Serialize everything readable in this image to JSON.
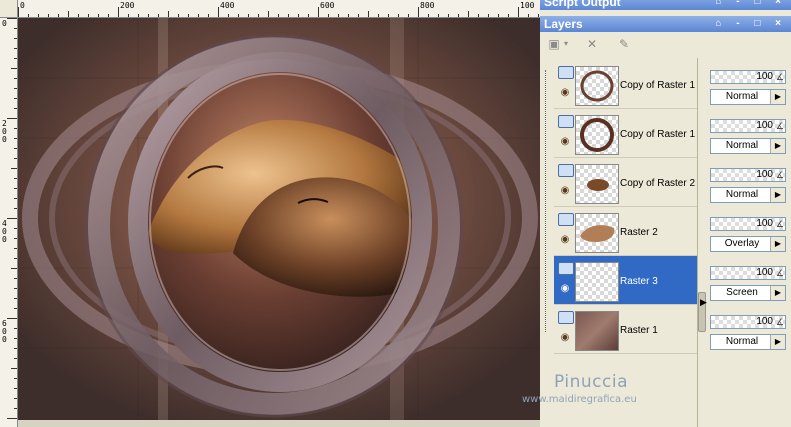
{
  "app": {
    "script_output_title": "Script Output",
    "layers_title": "Layers",
    "title_buttons": "⌂ - □ ×"
  },
  "rulers": {
    "top_labels": [
      "0",
      "200",
      "400",
      "600",
      "800",
      "100"
    ],
    "left_labels": [
      "0",
      "2 0 0",
      "4 0 0",
      "6 0 0"
    ]
  },
  "toolbar": {
    "icons": [
      "new-layer-icon",
      "dropdown-arrow-icon",
      "delete-layer-icon",
      "properties-icon"
    ]
  },
  "layers": [
    {
      "name": "Copy of Raster 1",
      "opacity": "100",
      "blend": "Normal",
      "thumb": "ring",
      "selected": false
    },
    {
      "name": "Copy of Raster 1",
      "opacity": "100",
      "blend": "Normal",
      "thumb": "ring-thin",
      "selected": false
    },
    {
      "name": "Copy of Raster 2",
      "opacity": "100",
      "blend": "Normal",
      "thumb": "blob",
      "selected": false
    },
    {
      "name": "Raster 2",
      "opacity": "100",
      "blend": "Overlay",
      "thumb": "faces",
      "selected": false
    },
    {
      "name": "Raster 3",
      "opacity": "100",
      "blend": "Screen",
      "thumb": "empty",
      "selected": true
    },
    {
      "name": "Raster 1",
      "opacity": "100",
      "blend": "Normal",
      "thumb": "texture",
      "selected": false
    }
  ],
  "watermark": {
    "name": "Pinuccia",
    "url": "www.maidiregrafica.eu"
  },
  "colors": {
    "selection": "#316ac5",
    "panel_bg": "#ece9d8",
    "titlebar": "#5b86d4"
  }
}
